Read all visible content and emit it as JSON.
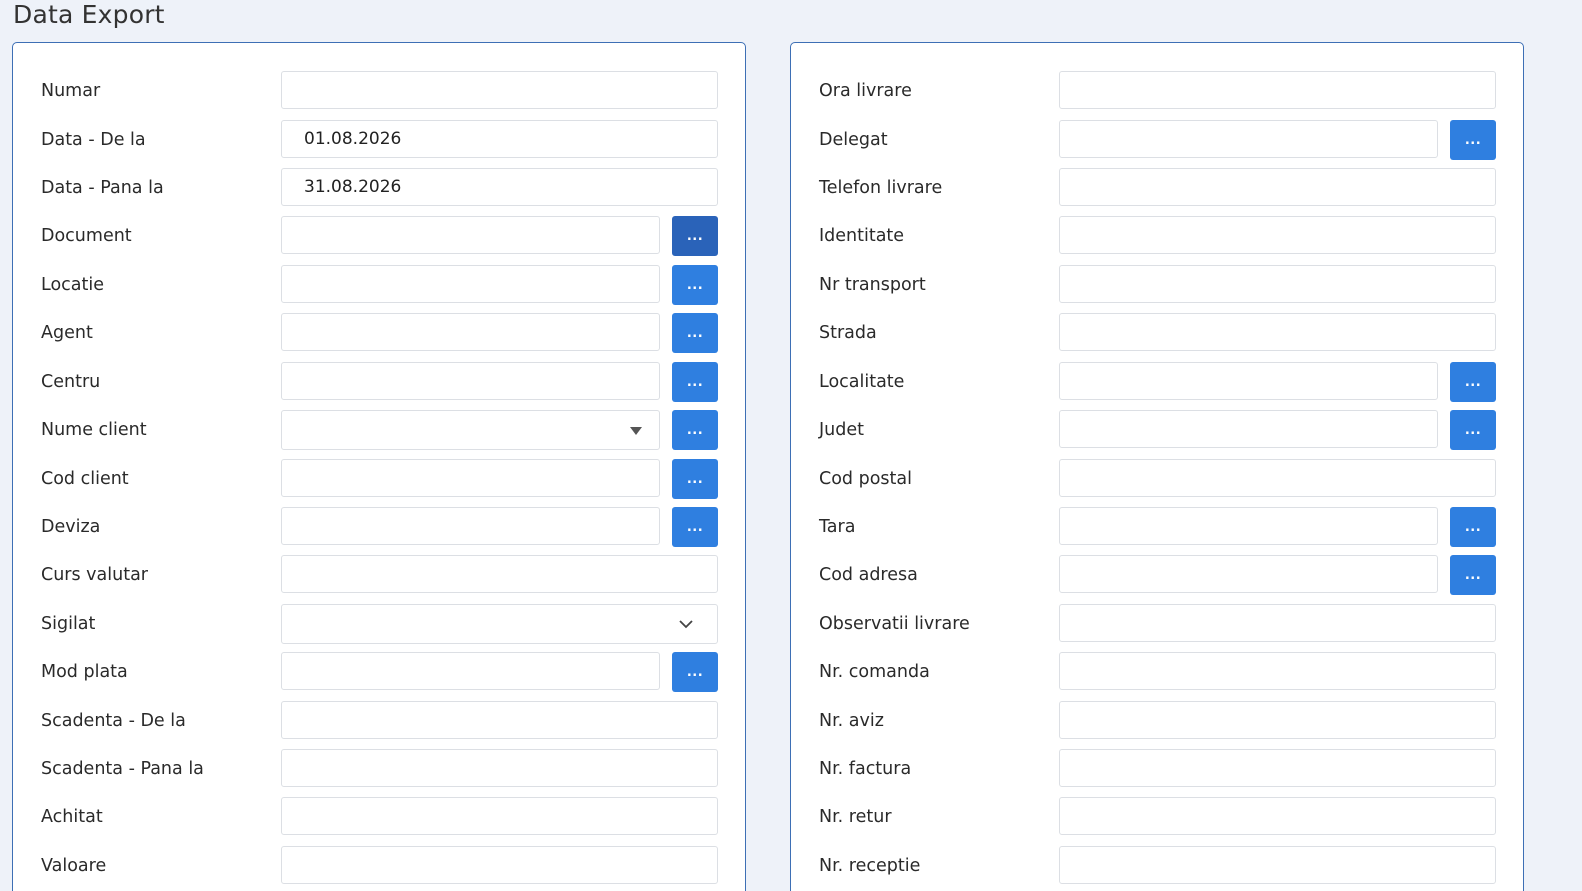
{
  "page": {
    "title": "Data Export"
  },
  "left": {
    "numar": {
      "label": "Numar",
      "value": ""
    },
    "data_de_la": {
      "label": "Data - De la",
      "value": "01.08.2026"
    },
    "data_pana_la": {
      "label": "Data - Pana la",
      "value": "31.08.2026"
    },
    "document": {
      "label": "Document",
      "value": "",
      "button": "..."
    },
    "locatie": {
      "label": "Locatie",
      "value": "",
      "button": "..."
    },
    "agent": {
      "label": "Agent",
      "value": "",
      "button": "..."
    },
    "centru": {
      "label": "Centru",
      "value": "",
      "button": "..."
    },
    "nume_client": {
      "label": "Nume client",
      "value": "",
      "button": "..."
    },
    "cod_client": {
      "label": "Cod client",
      "value": "",
      "button": "..."
    },
    "deviza": {
      "label": "Deviza",
      "value": "",
      "button": "..."
    },
    "curs_valutar": {
      "label": "Curs valutar",
      "value": ""
    },
    "sigilat": {
      "label": "Sigilat",
      "value": ""
    },
    "mod_plata": {
      "label": "Mod plata",
      "value": "",
      "button": "..."
    },
    "scadenta_de_la": {
      "label": "Scadenta - De la",
      "value": ""
    },
    "scadenta_pana_la": {
      "label": "Scadenta - Pana la",
      "value": ""
    },
    "achitat": {
      "label": "Achitat",
      "value": ""
    },
    "valoare": {
      "label": "Valoare",
      "value": ""
    }
  },
  "right": {
    "ora_livrare": {
      "label": "Ora livrare",
      "value": ""
    },
    "delegat": {
      "label": "Delegat",
      "value": "",
      "button": "..."
    },
    "telefon_livrare": {
      "label": "Telefon livrare",
      "value": ""
    },
    "identitate": {
      "label": "Identitate",
      "value": ""
    },
    "nr_transport": {
      "label": "Nr transport",
      "value": ""
    },
    "strada": {
      "label": "Strada",
      "value": ""
    },
    "localitate": {
      "label": "Localitate",
      "value": "",
      "button": "..."
    },
    "judet": {
      "label": "Judet",
      "value": "",
      "button": "..."
    },
    "cod_postal": {
      "label": "Cod postal",
      "value": ""
    },
    "tara": {
      "label": "Tara",
      "value": "",
      "button": "..."
    },
    "cod_adresa": {
      "label": "Cod adresa",
      "value": "",
      "button": "..."
    },
    "observatii_livrare": {
      "label": "Observatii livrare",
      "value": ""
    },
    "nr_comanda": {
      "label": "Nr. comanda",
      "value": ""
    },
    "nr_aviz": {
      "label": "Nr. aviz",
      "value": ""
    },
    "nr_factura": {
      "label": "Nr. factura",
      "value": ""
    },
    "nr_retur": {
      "label": "Nr. retur",
      "value": ""
    },
    "nr_receptie": {
      "label": "Nr. receptie",
      "value": ""
    }
  },
  "colors": {
    "accent": "#2f7fe0",
    "accent_active": "#2a63b9",
    "panel_border": "#3d6fb5",
    "background": "#eef2f9"
  },
  "icons": {
    "dropdown": "caret-down-icon",
    "select": "chevron-down-icon"
  }
}
